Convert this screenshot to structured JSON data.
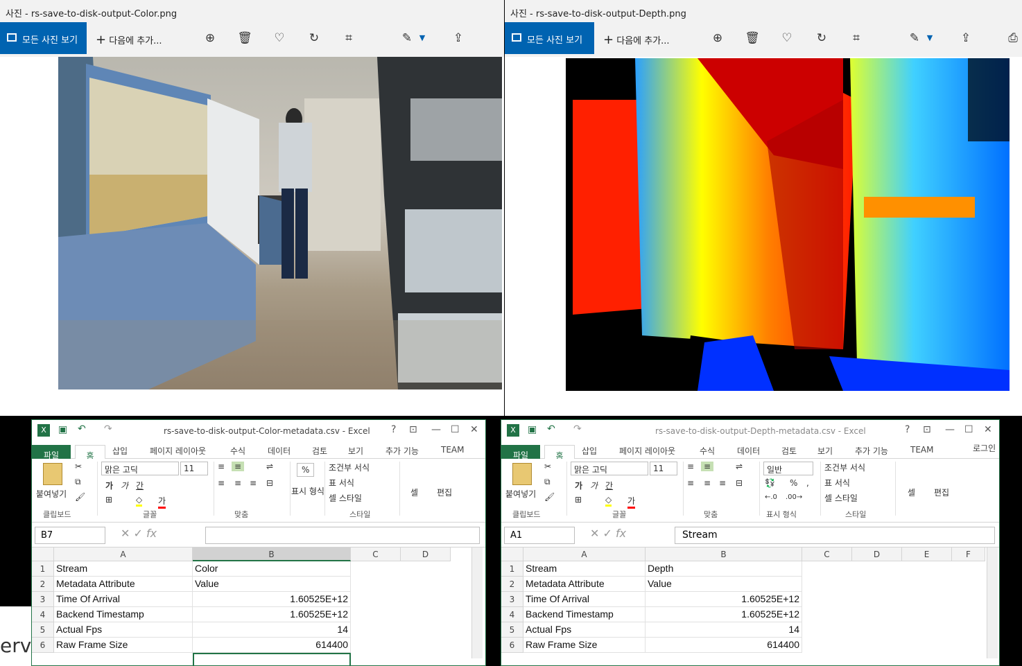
{
  "photo_left": {
    "title": "사진 - rs-save-to-disk-output-Color.png",
    "all_photos": "모든 사진 보기",
    "add_to": "다음에 추가..."
  },
  "photo_right": {
    "title": "사진 - rs-save-to-disk-output-Depth.png",
    "all_photos": "모든 사진 보기",
    "add_to": "다음에 추가..."
  },
  "excel_left": {
    "title": "rs-save-to-disk-output-Color-metadata.csv - Excel",
    "tabs": [
      "파일",
      "홈",
      "삽입",
      "페이지 레이아웃",
      "수식",
      "데이터",
      "검토",
      "보기",
      "추가 기능",
      "TEAM"
    ],
    "font_name": "맑은 고딕",
    "font_size": "11",
    "groups": [
      "클립보드",
      "글꼴",
      "맞춤",
      "스타일"
    ],
    "paste": "붙여넣기",
    "number_format": "표시 형식",
    "cond_format": "조건부 서식",
    "table_format": "표 서식",
    "cell_style": "셀 스타일",
    "cells": "셀",
    "edit": "편집",
    "name_box": "B7",
    "formula": "",
    "columns": [
      "A",
      "B",
      "C",
      "D"
    ],
    "rows": [
      [
        "1",
        "Stream",
        "Color"
      ],
      [
        "2",
        "Metadata Attribute",
        "Value"
      ],
      [
        "3",
        "Time Of Arrival",
        "1.60525E+12"
      ],
      [
        "4",
        "Backend Timestamp",
        "1.60525E+12"
      ],
      [
        "5",
        "Actual Fps",
        "14"
      ],
      [
        "6",
        "Raw Frame Size",
        "614400"
      ]
    ]
  },
  "excel_right": {
    "title": "rs-save-to-disk-output-Depth-metadata.csv - Excel",
    "tabs": [
      "파일",
      "홈",
      "삽입",
      "페이지 레이아웃",
      "수식",
      "데이터",
      "검토",
      "보기",
      "추가 기능",
      "TEAM"
    ],
    "login": "로그인",
    "font_name": "맑은 고딕",
    "font_size": "11",
    "number_format_value": "일반",
    "groups": [
      "클립보드",
      "글꼴",
      "맞춤",
      "표시 형식",
      "스타일"
    ],
    "paste": "붙여넣기",
    "cond_format": "조건부 서식",
    "table_format": "표 서식",
    "cell_style": "셀 스타일",
    "cells": "셀",
    "edit": "편집",
    "name_box": "A1",
    "formula": "Stream",
    "columns": [
      "A",
      "B",
      "C",
      "D",
      "E",
      "F"
    ],
    "rows": [
      [
        "1",
        "Stream",
        "Depth"
      ],
      [
        "2",
        "Metadata Attribute",
        "Value"
      ],
      [
        "3",
        "Time Of Arrival",
        "1.60525E+12"
      ],
      [
        "4",
        "Backend Timestamp",
        "1.60525E+12"
      ],
      [
        "5",
        "Actual Fps",
        "14"
      ],
      [
        "6",
        "Raw Frame Size",
        "614400"
      ]
    ]
  },
  "background_text": "erv"
}
